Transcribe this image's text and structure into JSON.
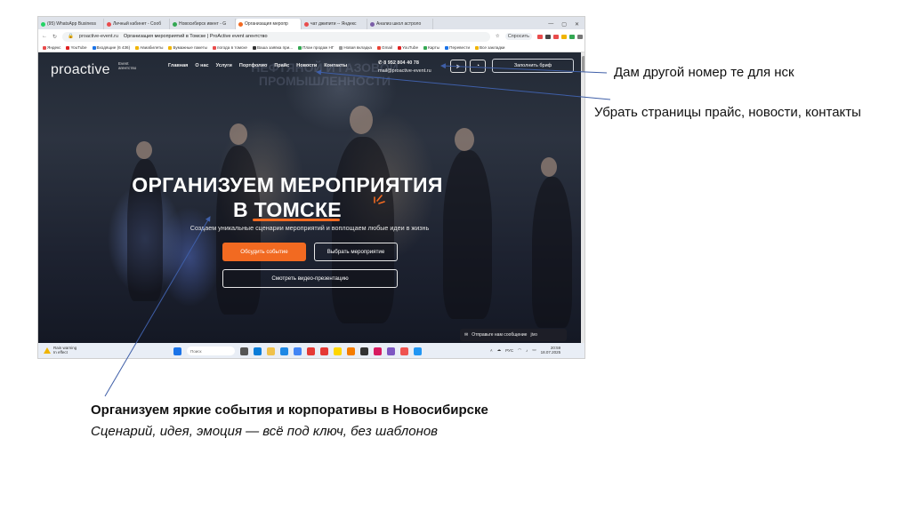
{
  "browser": {
    "tabs": [
      {
        "label": "(95) WhatsApp Business",
        "color": "#25d366"
      },
      {
        "label": "Личный кабинет - Сооб",
        "color": "#e94c4c"
      },
      {
        "label": "Новосибирск ивент - G",
        "color": "#34a853"
      },
      {
        "label": "Организация меропр",
        "color": "#f26a21",
        "active": true
      },
      {
        "label": "чат джипити -- Яндекс",
        "color": "#e94c4c"
      },
      {
        "label": "Анализ школ астроло",
        "color": "#7b5ea7"
      }
    ],
    "window_controls": [
      "—",
      "▢",
      "✕"
    ],
    "url": "proactive-event.ru",
    "page_title": "Организация мероприятий в Томске | ProActive event агентство",
    "ask_label": "Спросить",
    "bookmarks": [
      "Яндекс",
      "YouTube",
      "Входящие (6 436)",
      "Авиабилеты",
      "Бумажные пакеты",
      "погода в томске",
      "Ваша заявка при...",
      "План продаж НГ",
      "Новая вкладка",
      "Gmail",
      "YouTube",
      "Карты",
      "Перевести",
      "Все закладки"
    ]
  },
  "site": {
    "logo": "proactive",
    "logo_sub": [
      "Event",
      "агентство"
    ],
    "menu": [
      "Главная",
      "О нас",
      "Услуги",
      "Портфолио",
      "Прайс",
      "Новости",
      "Контакты"
    ],
    "phone": "8 952 804 40 78",
    "email": "mail@proactive-event.ru",
    "brief_button": "Заполнить бриф",
    "bg_text": [
      "НЕФТЯНОЙ И ГАЗОВОЙ",
      "ПРОМЫШЛЕННОСТИ"
    ],
    "headline_line1": "ОРГАНИЗУЕМ МЕРОПРИЯТИЯ",
    "headline_line2": "В ТОМСКЕ",
    "subtitle": "Создаем уникальные сценарии мероприятий и воплощаем любые идеи в жизнь",
    "btn_discuss": "Обсудить событие",
    "btn_choose": "Выбрать мероприятие",
    "btn_video": "Смотреть видео-презентацию",
    "message_bar": "Отправьте нам сообщение",
    "message_brand": "jivo"
  },
  "taskbar": {
    "weather_line1": "Rain warning",
    "weather_line2": "In effect",
    "search_placeholder": "Поиск",
    "lang": "РУС",
    "time": "20:59",
    "date": "18.07.2025"
  },
  "annotations": {
    "phone_note": "Дам другой номер те для нск",
    "menu_note": "Убрать страницы прайс, новости, контакты",
    "caption_title": "Организуем яркие события и корпоративы в Новосибирске",
    "caption_subtitle": "Сценарий, идея, эмоция — всё под ключ, без шаблонов"
  },
  "colors": {
    "accent": "#f26a21",
    "arrow": "#3f5fa8"
  }
}
